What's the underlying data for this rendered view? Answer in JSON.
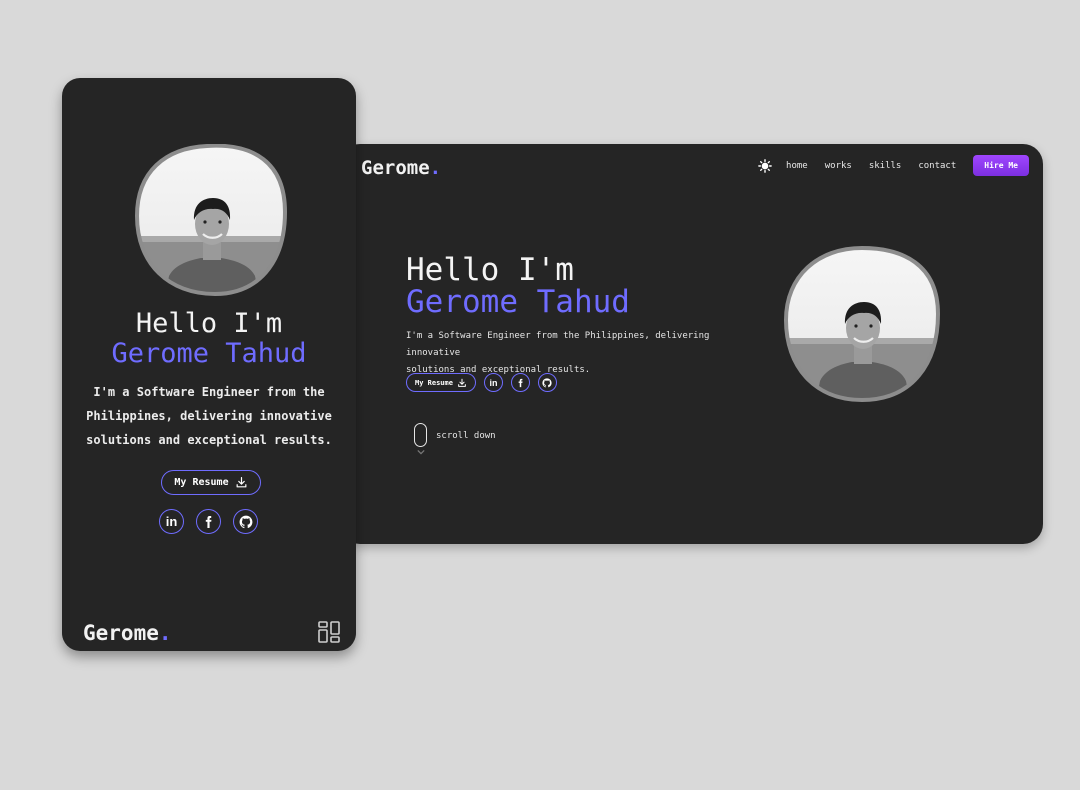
{
  "brand": {
    "name": "Gerome",
    "dot": "."
  },
  "nav": {
    "links": [
      "home",
      "works",
      "skills",
      "contact"
    ],
    "cta": "Hire Me",
    "theme_icon": "sun-icon"
  },
  "hero": {
    "greeting": "Hello I'm",
    "name": "Gerome Tahud",
    "desc_desktop_line1": "I'm a Software Engineer from the Philippines, delivering innovative",
    "desc_desktop_line2": "solutions and exceptional results.",
    "desc_mobile_line1": "I'm a Software Engineer from the",
    "desc_mobile_line2": "Philippines, delivering innovative",
    "desc_mobile_line3": "solutions and exceptional results.",
    "resume_label": "My Resume",
    "socials": [
      "linkedin-icon",
      "facebook-icon",
      "github-icon"
    ],
    "scroll_label": "scroll down"
  },
  "colors": {
    "background": "#d9d9d9",
    "card": "#252525",
    "accent": "#6f6cff",
    "cta": "#9b45ff"
  }
}
